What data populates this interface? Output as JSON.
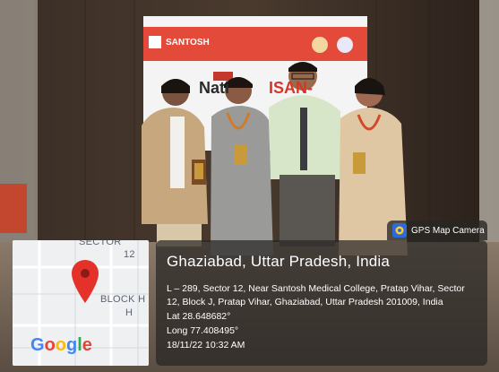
{
  "photo": {
    "banner": {
      "logo_text": "SANTOSH",
      "headline_part1": "Nati",
      "headline_part2": "ISAN-"
    }
  },
  "gps_camera": {
    "app_name": "GPS Map Camera",
    "location_title": "Ghaziabad, Uttar Pradesh, India",
    "address": "L – 289, Sector 12, Near Santosh Medical College, Pratap Vihar, Sector 12, Block J, Pratap Vihar, Ghaziabad, Uttar Pradesh 201009, India",
    "latitude": "Lat 28.648682°",
    "longitude": "Long 77.408495°",
    "datetime": "18/11/22 10:32 AM"
  },
  "map": {
    "labels": {
      "sector": "SECTOR",
      "sector_num": "12",
      "block": "BLOCK H",
      "block_h": "H"
    },
    "brand": "Google",
    "colors": {
      "pin": "#e4322b",
      "google_blue": "#4285f4",
      "google_red": "#ea4335",
      "google_yellow": "#fbbc05",
      "google_green": "#34a853"
    }
  }
}
